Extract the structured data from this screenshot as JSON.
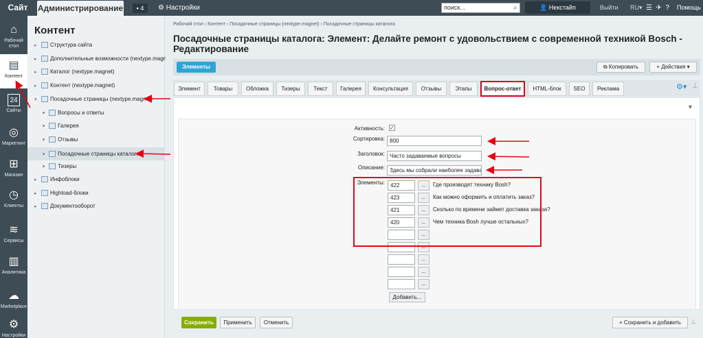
{
  "topbar": {
    "site_tab": "Сайт",
    "admin_tab": "Администрирование",
    "notifications_count": "4",
    "settings_label": "Настройки",
    "search_placeholder": "поиск...",
    "user_name": "Некстайп Некстайпов",
    "logout_label": "Выйти",
    "language": "RU",
    "help_label": "Помощь"
  },
  "leftnav": {
    "items": [
      {
        "label": "Рабочий стол",
        "icon": "home-icon"
      },
      {
        "label": "Контент",
        "icon": "document-icon"
      },
      {
        "label": "Сайты",
        "icon": "calendar-icon"
      },
      {
        "label": "Маркетинг",
        "icon": "target-icon"
      },
      {
        "label": "Магазин",
        "icon": "cart-icon"
      },
      {
        "label": "Клиенты",
        "icon": "clock-icon"
      },
      {
        "label": "Сервисы",
        "icon": "layers-icon"
      },
      {
        "label": "Аналитика",
        "icon": "bar-chart-icon"
      },
      {
        "label": "Marketplace",
        "icon": "cloud-icon"
      },
      {
        "label": "Настройки",
        "icon": "gear-icon"
      }
    ],
    "calendar_day": "24"
  },
  "tree": {
    "title": "Контент",
    "items": [
      "Структура сайта",
      "Дополнительные возможности (nextype.magnet)",
      "Каталог (nextype.magnet)",
      "Контент (nextype.magnet)",
      "Посадочные страницы (nextype.magnet)",
      "Вопросы и ответы",
      "Галерея",
      "Отзывы",
      "Посадочные страницы каталога",
      "Тизеры",
      "Инфоблоки",
      "Highload-блоки",
      "Документооборот"
    ]
  },
  "main": {
    "breadcrumb": "Рабочий стол  ›  Контент  ›  Посадочные страницы (nextype.magnet)  ›  Посадочные страницы каталога",
    "title": "Посадочные страницы каталога: Элемент: Делайте ремонт с удовольствием с современной техникой Bosch - Редактирование",
    "elements_button": "Элементы",
    "copy_button": "Копировать",
    "actions_button": "Действия",
    "tabs": [
      "Элемент",
      "Товары",
      "Обложка",
      "Тизеры",
      "Текст",
      "Галерея",
      "Консультация",
      "Отзывы",
      "Этапы",
      "Вопрос-ответ",
      "HTML-блок",
      "SEO",
      "Реклама"
    ],
    "active_tab": "Вопрос-ответ"
  },
  "form": {
    "active_label": "Активность:",
    "sort_label": "Сортировка:",
    "sort_value": "800",
    "heading_label": "Заголовок:",
    "heading_value": "Часто задаваемые вопросы",
    "description_label": "Описание:",
    "description_value": "Здесь мы собрали наиболее задаваемые",
    "elements_label": "Элементы:",
    "elements": [
      {
        "id": "422",
        "name": "Где производят технику Bosh?"
      },
      {
        "id": "423",
        "name": "Как можно оформить и оплатить заказ?"
      },
      {
        "id": "421",
        "name": "Сколько по времени займет доставка заказа?"
      },
      {
        "id": "420",
        "name": "Чем техника Bosh лучше остальных?"
      },
      {
        "id": "",
        "name": ""
      },
      {
        "id": "",
        "name": ""
      },
      {
        "id": "",
        "name": ""
      },
      {
        "id": "",
        "name": ""
      },
      {
        "id": "",
        "name": ""
      }
    ],
    "dots_label": "...",
    "add_button": "Добавить..."
  },
  "footer": {
    "save": "Сохранить",
    "apply": "Применить",
    "cancel": "Отменить",
    "save_add": "Сохранить и добавить"
  },
  "colors": {
    "accent_blue": "#2fa5d6",
    "save_green": "#86ad00",
    "annotation_red": "#e30613",
    "dark_nav": "#3d4c55"
  }
}
